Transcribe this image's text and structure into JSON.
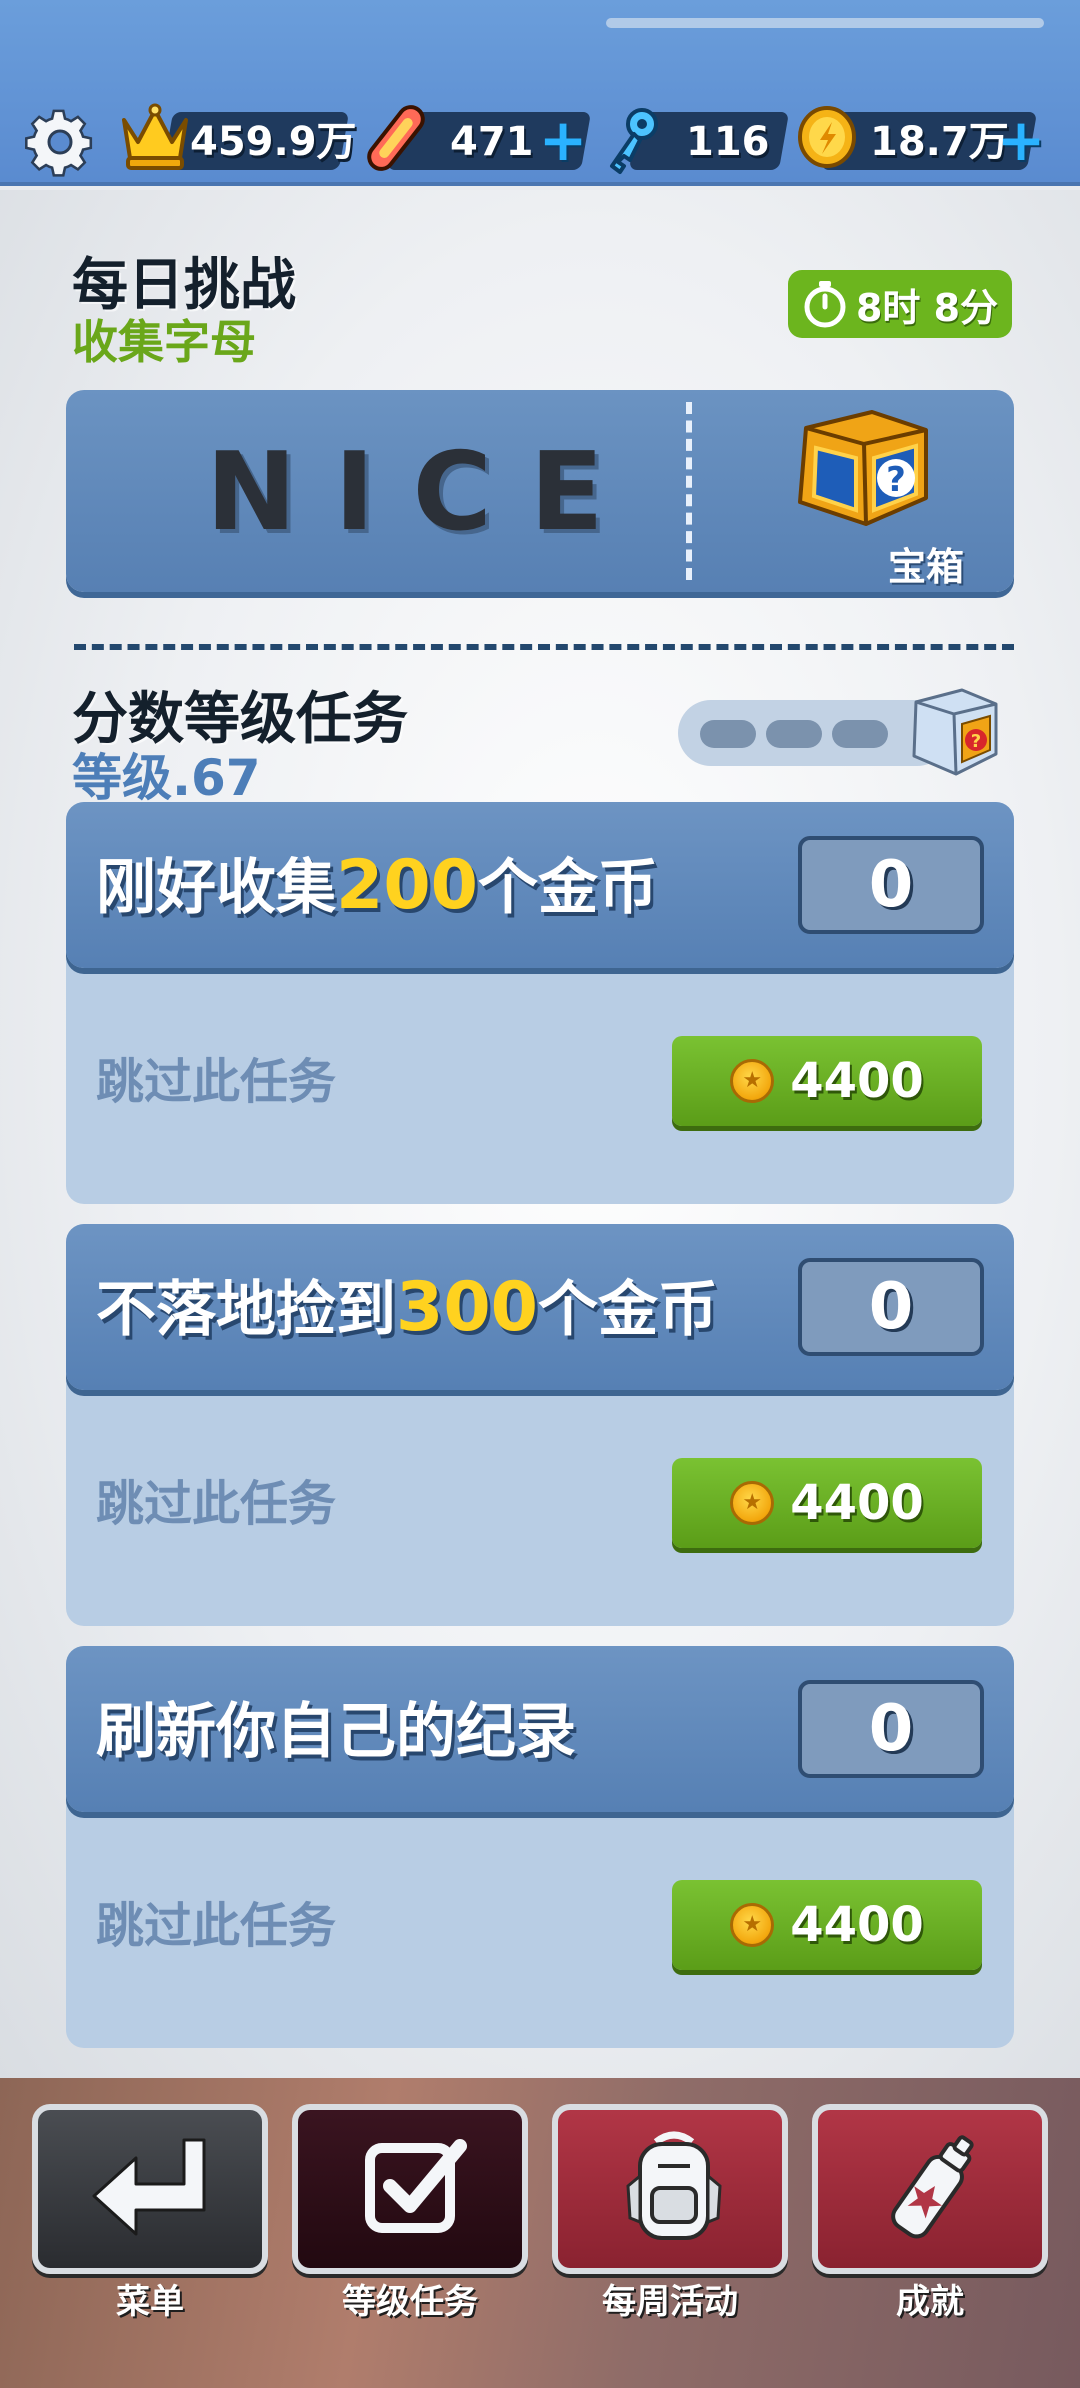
{
  "topbar": {
    "crowns": "459.9万",
    "boards": "471",
    "keys": "116",
    "coins": "18.7万",
    "plus_symbol": "+"
  },
  "daily": {
    "title": "每日挑战",
    "subtitle": "收集字母",
    "timer": "8时 8分",
    "word": "NICE",
    "chest_label": "宝箱"
  },
  "score_missions": {
    "title": "分数等级任务",
    "level": "等级.67"
  },
  "missions": [
    {
      "title_pre": "刚好收集",
      "title_num": "200",
      "title_post": "个金币",
      "progress": "0",
      "skip_label": "跳过此任务",
      "skip_cost": "4400"
    },
    {
      "title_pre": "不落地捡到",
      "title_num": "300",
      "title_post": "个金币",
      "progress": "0",
      "skip_label": "跳过此任务",
      "skip_cost": "4400"
    },
    {
      "title_pre": "刷新你自己的纪录",
      "title_num": "",
      "title_post": "",
      "progress": "0",
      "skip_label": "跳过此任务",
      "skip_cost": "4400"
    }
  ],
  "nav": {
    "menu": "菜单",
    "missions": "等级任务",
    "weekly": "每周活动",
    "achievements": "成就"
  },
  "colors": {
    "accent_blue": "#5a8bd0",
    "card_blue": "#5780b3",
    "button_green": "#6cb51e",
    "title_yellow": "#ffd21f",
    "nav_red": "#9a2a37",
    "nav_dark": "#2c1018"
  },
  "icons": {
    "settings": "gear-icon",
    "crowns": "crown-icon",
    "boards": "hoverboard-icon",
    "keys": "key-icon",
    "coins": "coin-icon",
    "timer": "stopwatch-icon",
    "chest": "mystery-box-icon",
    "menu": "return-arrow-icon",
    "missions": "checkbox-icon",
    "weekly": "backpack-icon",
    "achievements": "spray-can-icon"
  }
}
